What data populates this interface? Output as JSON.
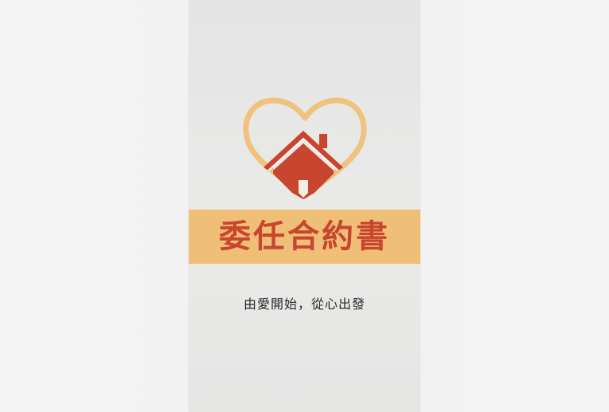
{
  "document": {
    "title": "委任合約書",
    "slogan": "由愛開始，從心出發"
  },
  "colors": {
    "band": "#f0bf77",
    "title": "#c8452f",
    "heart_outline": "#efc27d",
    "house": "#c8452f"
  },
  "logo": {
    "icon": "heart-house-logo"
  }
}
